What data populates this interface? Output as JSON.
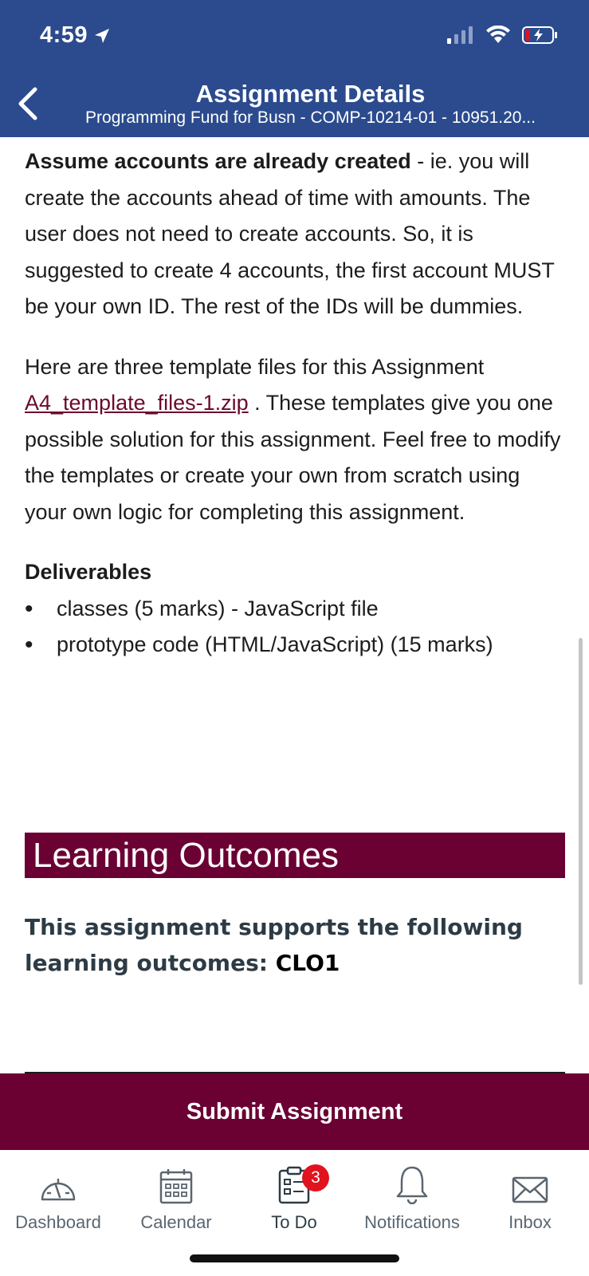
{
  "status_bar": {
    "time": "4:59"
  },
  "header": {
    "title": "Assignment Details",
    "subtitle": "Programming Fund for Busn - COMP-10214-01 - 10951.20..."
  },
  "content": {
    "para1_bold": "Assume accounts are already created",
    "para1_rest": " - ie. you will create the accounts ahead of time with amounts.  The user does not need to create accounts. So, it is suggested to create 4 accounts, the first account MUST be your own ID. The rest of the IDs will be dummies.",
    "para2_start": "Here are three template files for this Assignment ",
    "para2_link": "A4_template_files-1.zip",
    "para2_rest": " .  These templates give you one possible solution for this assignment. Feel free to modify the templates or create your own from scratch using your own logic for completing this assignment.",
    "deliverables_title": "Deliverables",
    "deliverables": [
      "classes (5 marks) - JavaScript file",
      "prototype code (HTML/JavaScript) (15 marks)"
    ]
  },
  "learning_outcomes": {
    "banner": "Learning Outcomes",
    "text": "This assignment supports the following learning outcomes: ",
    "clo": "CLO1"
  },
  "submit_label": "Submit Assignment",
  "tabbar": {
    "items": [
      {
        "label": "Dashboard",
        "icon": "dashboard-icon"
      },
      {
        "label": "Calendar",
        "icon": "calendar-icon"
      },
      {
        "label": "To Do",
        "icon": "todo-icon",
        "badge": "3"
      },
      {
        "label": "Notifications",
        "icon": "bell-icon"
      },
      {
        "label": "Inbox",
        "icon": "inbox-icon"
      }
    ]
  }
}
